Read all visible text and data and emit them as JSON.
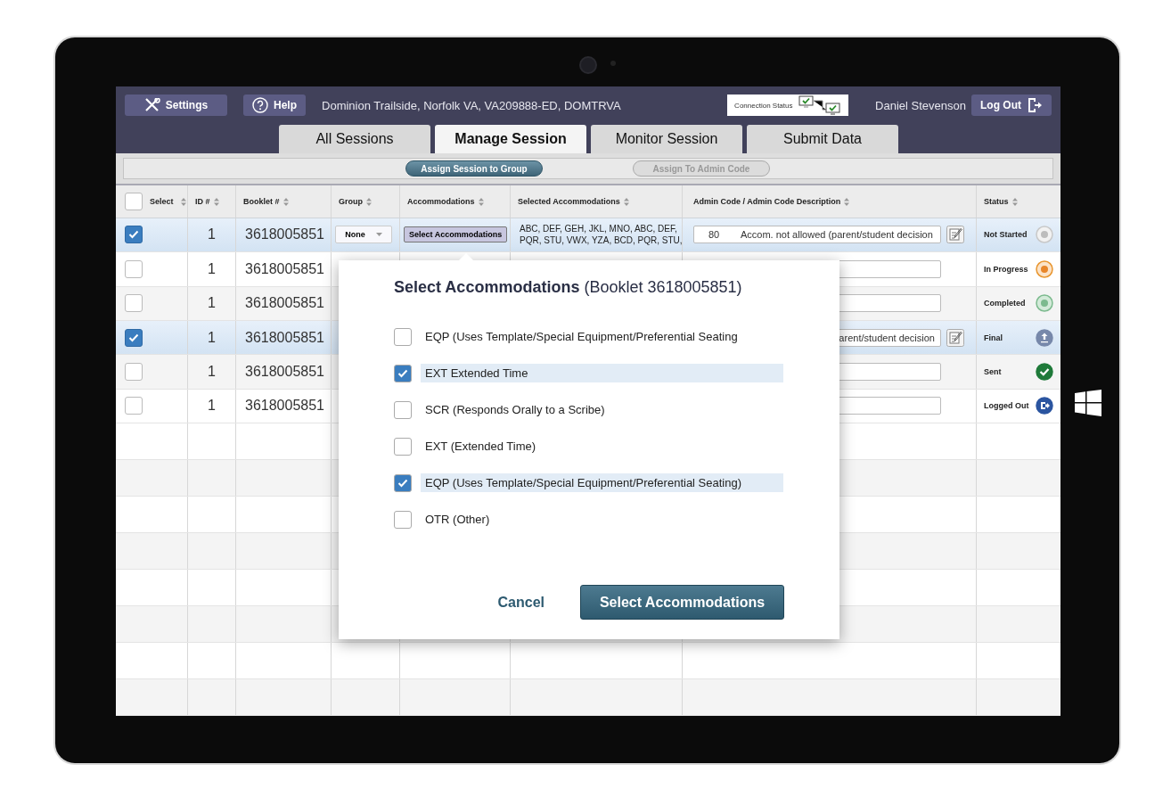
{
  "header": {
    "settings_label": "Settings",
    "help_label": "Help",
    "school": "Dominion Trailside, Norfolk VA, VA209888-ED, DOMTRVA",
    "connection_label": "Connection Status",
    "user": "Daniel Stevenson",
    "logout_label": "Log Out"
  },
  "tabs": [
    {
      "label": "All Sessions",
      "selected": false
    },
    {
      "label": "Manage Session",
      "selected": true
    },
    {
      "label": "Monitor Session",
      "selected": false
    },
    {
      "label": "Submit Data",
      "selected": false
    }
  ],
  "toolbar": {
    "buttons": [
      {
        "label": "Assign Session to Group",
        "disabled": false
      },
      {
        "label": "Assign To Admin Code",
        "disabled": true
      }
    ]
  },
  "table": {
    "select_all_checked": false,
    "columns": [
      "Select",
      "ID #",
      "Booklet #",
      "Group",
      "Accommodations",
      "Selected Accommodations",
      "Admin Code / Admin Code Description",
      "Status"
    ],
    "rows": [
      {
        "checked": true,
        "id": "1",
        "booklet": "3618005851",
        "group": "None",
        "accommodations_button": "Select Accommodations",
        "selected_accommodations": [
          "ABC, DEF, GEH, JKL, MNO, ABC, DEF,",
          "PQR, STU, VWX, YZA, BCD, PQR, STU,"
        ],
        "admin_code": "80",
        "admin_description": "Accom. not allowed (parent/student decision",
        "edit_icon": true,
        "status": "Not Started",
        "kind": "not-started"
      },
      {
        "checked": false,
        "id": "1",
        "booklet": "3618005851",
        "edit_icon": false,
        "status": "In Progress",
        "kind": "in-progress"
      },
      {
        "checked": false,
        "id": "1",
        "booklet": "3618005851",
        "edit_icon": false,
        "status": "Completed",
        "kind": "completed"
      },
      {
        "checked": true,
        "id": "1",
        "booklet": "3618005851",
        "admin_description": "arent/student decision",
        "edit_icon": true,
        "status": "Final",
        "kind": "final"
      },
      {
        "checked": false,
        "id": "1",
        "booklet": "3618005851",
        "edit_icon": false,
        "status": "Sent",
        "kind": "sent"
      },
      {
        "checked": false,
        "id": "1",
        "booklet": "3618005851",
        "edit_icon": false,
        "status": "Logged Out",
        "kind": "logged-out"
      }
    ]
  },
  "modal": {
    "title": "**Select  Accommodations** (Booklet 3618005851)",
    "options": [
      {
        "label": "EQP (Uses Template/Special Equipment/Preferential Seating",
        "checked": false
      },
      {
        "label": "EXT Extended Time",
        "checked": true
      },
      {
        "label": "SCR (Responds Orally to a Scribe)",
        "checked": false
      },
      {
        "label": "EXT (Extended Time)",
        "checked": false
      },
      {
        "label": "EQP (Uses Template/Special Equipment/Preferential Seating)",
        "checked": true
      },
      {
        "label": "OTR (Other)",
        "checked": false
      }
    ],
    "cancel_label": "Cancel",
    "confirm_label": "Select Accommodations"
  }
}
